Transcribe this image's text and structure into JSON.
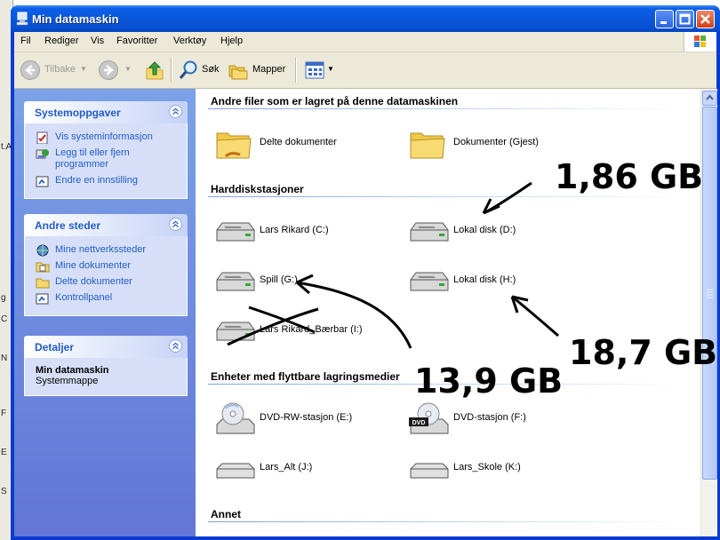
{
  "window": {
    "title": "Min datamaskin"
  },
  "menubar": {
    "items": [
      "Fil",
      "Rediger",
      "Vis",
      "Favoritter",
      "Verktøy",
      "Hjelp"
    ]
  },
  "toolbar": {
    "back_label": "Tilbake",
    "search_label": "Søk",
    "folders_label": "Mapper"
  },
  "sidebar": {
    "system_tasks": {
      "title": "Systemoppgaver",
      "items": [
        {
          "label": "Vis systeminformasjon",
          "icon": "system-info-icon"
        },
        {
          "label": "Legg til eller fjern programmer",
          "icon": "add-remove-programs-icon"
        },
        {
          "label": "Endre en innstilling",
          "icon": "control-panel-setting-icon"
        }
      ]
    },
    "other_places": {
      "title": "Andre steder",
      "items": [
        {
          "label": "Mine nettverkssteder",
          "icon": "network-places-icon"
        },
        {
          "label": "Mine dokumenter",
          "icon": "documents-folder-icon"
        },
        {
          "label": "Delte dokumenter",
          "icon": "folder-icon"
        },
        {
          "label": "Kontrollpanel",
          "icon": "control-panel-icon"
        }
      ]
    },
    "details": {
      "title": "Detaljer",
      "name": "Min datamaskin",
      "type": "Systemmappe"
    }
  },
  "main": {
    "groups": {
      "files": "Andre filer som er lagret på denne datamaskinen",
      "hdd": "Harddiskstasjoner",
      "removable": "Enheter med flyttbare lagringsmedier",
      "other": "Annet"
    },
    "items": {
      "shared_docs": "Delte dokumenter",
      "guest_docs": "Dokumenter (Gjest)",
      "drive_c": "Lars Rikard (C:)",
      "drive_d": "Lokal disk (D:)",
      "drive_g": "Spill (G:)",
      "drive_h": "Lokal disk (H:)",
      "drive_i": "Lars Rikard_Bærbar (I:)",
      "drive_e": "DVD-RW-stasjon (E:)",
      "drive_f": "DVD-stasjon (F:)",
      "drive_j": "Lars_Alt (J:)",
      "drive_k": "Lars_Skole (K:)"
    }
  },
  "annotations": {
    "d_size": "1,86 GB",
    "h_size": "18,7 GB",
    "g_size": "13,9 GB"
  },
  "colors": {
    "title_bar": "#0a58dc",
    "task_pane": "#6e8ddf",
    "link": "#215dc6"
  }
}
